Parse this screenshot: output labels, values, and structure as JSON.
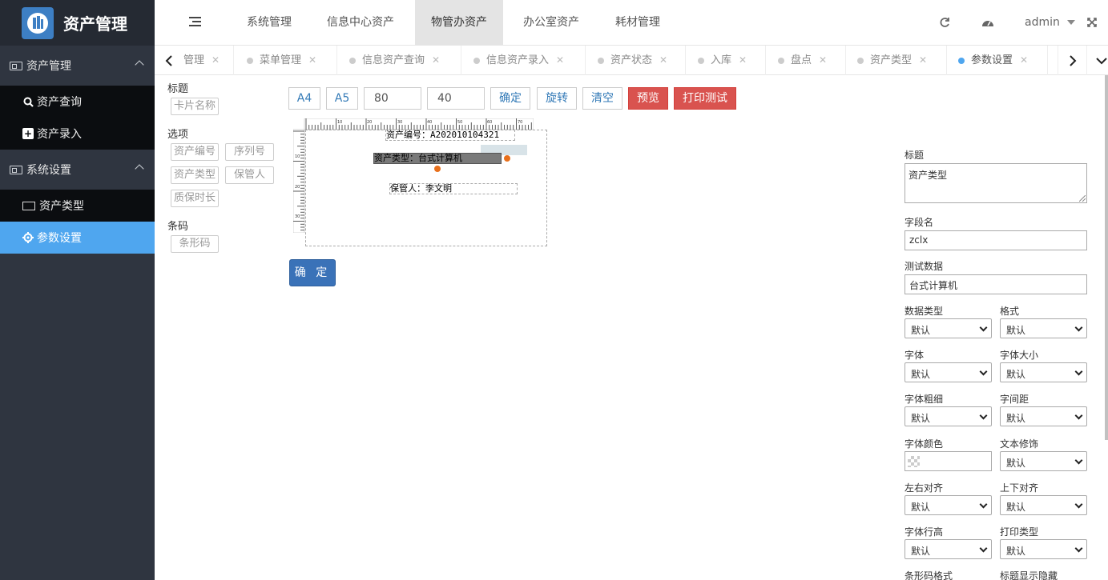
{
  "app": {
    "title": "资产管理"
  },
  "sidebar": {
    "groups": [
      {
        "label": "资产管理",
        "items": [
          {
            "label": "资产查询",
            "icon": "search-icon"
          },
          {
            "label": "资产录入",
            "icon": "plus-square-icon"
          }
        ]
      },
      {
        "label": "系统设置",
        "items": [
          {
            "label": "资产类型",
            "icon": "card-icon"
          },
          {
            "label": "参数设置",
            "icon": "gear-icon",
            "active": true
          }
        ]
      }
    ]
  },
  "topnav": {
    "tabs": [
      "系统管理",
      "信息中心资产",
      "物管办资产",
      "办公室资产",
      "耗材管理"
    ],
    "active_tab": "物管办资产",
    "user": "admin"
  },
  "page_tabs": [
    "管理",
    "菜单管理",
    "信息资产查询",
    "信息资产录入",
    "资产状态",
    "入库",
    "盘点",
    "资产类型",
    "参数设置"
  ],
  "active_page_tab": "参数设置",
  "palette": {
    "title_header": "标题",
    "title_items": [
      "卡片名称"
    ],
    "options_header": "选项",
    "options_items": [
      "资产编号",
      "序列号",
      "资产类型",
      "保管人",
      "质保时长"
    ],
    "barcode_header": "条码",
    "barcode_items": [
      "条形码"
    ]
  },
  "toolbar": {
    "a4": "A4",
    "a5": "A5",
    "width": "80",
    "height": "40",
    "confirm": "确定",
    "rotate": "旋转",
    "clear": "清空",
    "preview": "预览",
    "print_test": "打印测试"
  },
  "canvas": {
    "fields": [
      "资产编号：A202010104321",
      "资产类型：台式计算机",
      "保管人：李文明"
    ],
    "ruler_top_labels": [
      "10",
      "20",
      "30",
      "40",
      "50",
      "60",
      "70"
    ],
    "ruler_left_labels": [
      "10",
      "20",
      "30"
    ]
  },
  "confirm_button": "确 定",
  "props": {
    "title_label": "标题",
    "title_value": "资产类型",
    "field_label": "字段名",
    "field_value": "zclx",
    "test_label": "测试数据",
    "test_value": "台式计算机",
    "rows": [
      {
        "left_label": "数据类型",
        "left_value": "默认",
        "right_label": "格式",
        "right_value": "默认"
      },
      {
        "left_label": "字体",
        "left_value": "默认",
        "right_label": "字体大小",
        "right_value": "默认"
      },
      {
        "left_label": "字体粗细",
        "left_value": "默认",
        "right_label": "字间距",
        "right_value": "默认"
      },
      {
        "left_label": "字体颜色",
        "left_value": "",
        "right_label": "文本修饰",
        "right_value": "默认"
      },
      {
        "left_label": "左右对齐",
        "left_value": "默认",
        "right_label": "上下对齐",
        "right_value": "默认"
      },
      {
        "left_label": "字体行高",
        "left_value": "默认",
        "right_label": "打印类型",
        "right_value": "默认"
      },
      {
        "left_label": "条形码格式",
        "left_value": "",
        "right_label": "标题显示隐藏",
        "right_value": ""
      }
    ]
  },
  "colors": {
    "sidebar_bg": "#2f3540",
    "active_blue": "#4fa6ef",
    "danger": "#d9534f",
    "primary": "#3a72b8"
  }
}
